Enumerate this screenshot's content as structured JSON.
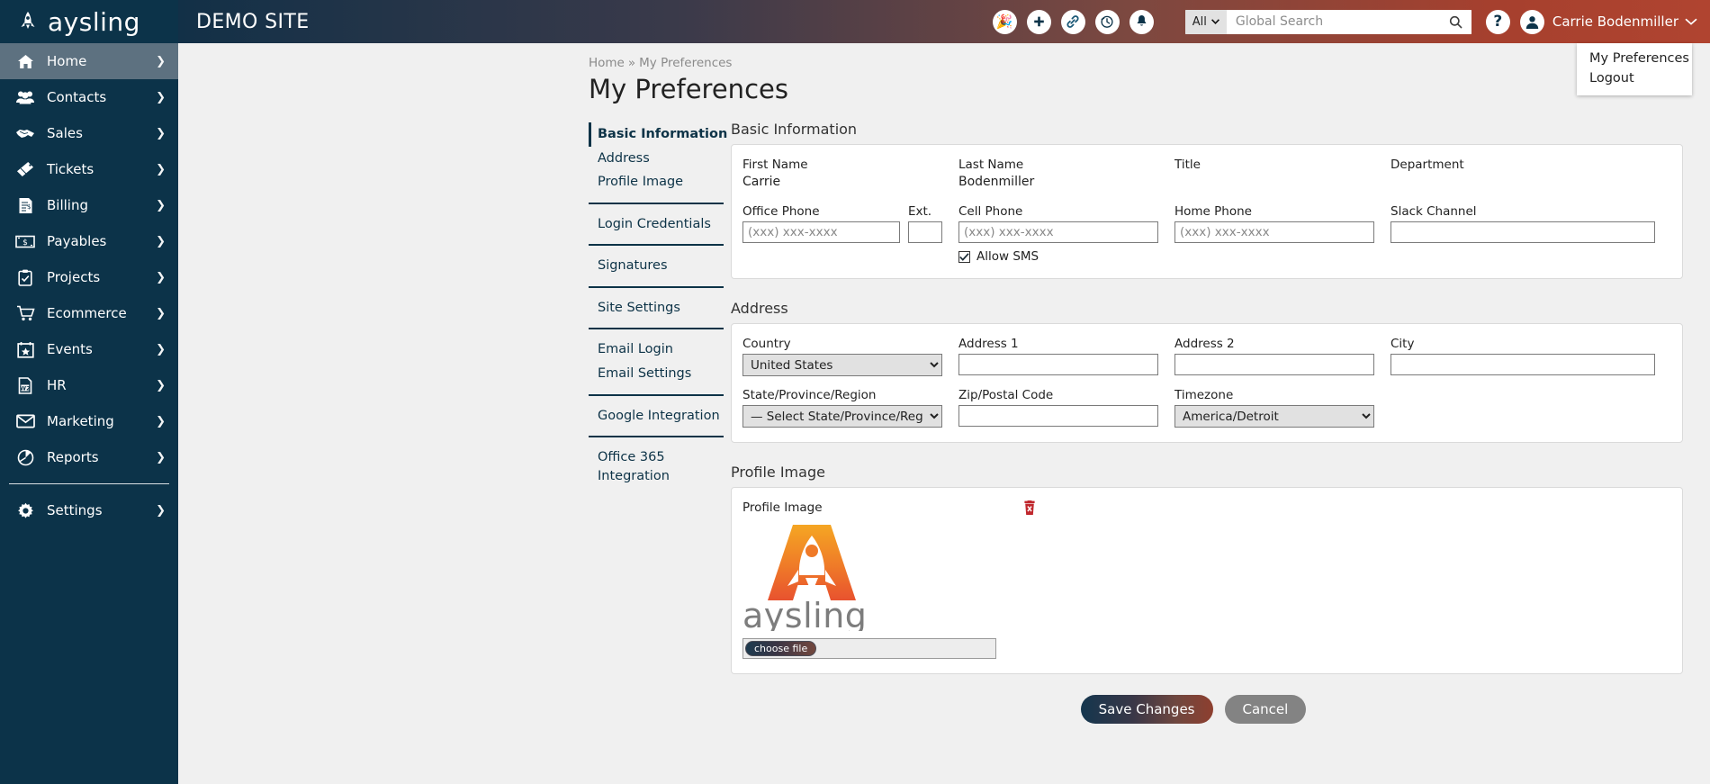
{
  "brand": {
    "word": "aysling",
    "logo_icon": "rocket-logo-icon"
  },
  "topbar": {
    "site_title": "DEMO SITE",
    "icons": [
      {
        "name": "celebrate-icon",
        "glyph": "🎉"
      },
      {
        "name": "add-icon",
        "glyph": "+"
      },
      {
        "name": "link-icon",
        "glyph": "🔗"
      },
      {
        "name": "recent-history-icon",
        "glyph": "◴"
      },
      {
        "name": "notifications-bell-icon",
        "glyph": "🔔"
      }
    ],
    "search": {
      "scope": "All",
      "placeholder": "Global Search",
      "value": ""
    },
    "help_label": "?",
    "user_name": "Carrie Bodenmiller",
    "user_menu": [
      "My Preferences",
      "Logout"
    ]
  },
  "sidebar": {
    "items": [
      {
        "label": "Home",
        "icon": "home-icon",
        "active": true
      },
      {
        "label": "Contacts",
        "icon": "contacts-icon",
        "active": false
      },
      {
        "label": "Sales",
        "icon": "handshake-icon",
        "active": false
      },
      {
        "label": "Tickets",
        "icon": "ticket-icon",
        "active": false
      },
      {
        "label": "Billing",
        "icon": "invoice-icon",
        "active": false
      },
      {
        "label": "Payables",
        "icon": "money-icon",
        "active": false
      },
      {
        "label": "Projects",
        "icon": "clipboard-check-icon",
        "active": false
      },
      {
        "label": "Ecommerce",
        "icon": "shopping-cart-icon",
        "active": false
      },
      {
        "label": "Events",
        "icon": "calendar-star-icon",
        "active": false
      },
      {
        "label": "HR",
        "icon": "w2-document-icon",
        "active": false
      },
      {
        "label": "Marketing",
        "icon": "envelope-icon",
        "active": false
      },
      {
        "label": "Reports",
        "icon": "pie-chart-icon",
        "active": false
      },
      {
        "label": "Settings",
        "icon": "gear-icon",
        "active": false
      }
    ],
    "chevron": "❯"
  },
  "page": {
    "breadcrumb": {
      "home": "Home",
      "separator": "»",
      "current": "My Preferences"
    },
    "title": "My Preferences"
  },
  "subnav": {
    "groups": [
      [
        "Basic Information",
        "Address",
        "Profile Image"
      ],
      [
        "Login Credentials"
      ],
      [
        "Signatures"
      ],
      [
        "Site Settings"
      ],
      [
        "Email Login",
        "Email Settings"
      ],
      [
        "Google Integration"
      ],
      [
        "Office 365 Integration"
      ]
    ],
    "active": "Basic Information"
  },
  "basic_information": {
    "section_title": "Basic Information",
    "first_name": {
      "label": "First Name",
      "value": "Carrie"
    },
    "last_name": {
      "label": "Last Name",
      "value": "Bodenmiller"
    },
    "title": {
      "label": "Title",
      "value": ""
    },
    "department": {
      "label": "Department",
      "value": ""
    },
    "office_phone": {
      "label": "Office Phone",
      "placeholder": "(xxx) xxx-xxxx",
      "value": ""
    },
    "ext": {
      "label": "Ext.",
      "value": ""
    },
    "cell_phone": {
      "label": "Cell Phone",
      "placeholder": "(xxx) xxx-xxxx",
      "value": ""
    },
    "home_phone": {
      "label": "Home Phone",
      "placeholder": "(xxx) xxx-xxxx",
      "value": ""
    },
    "slack_channel": {
      "label": "Slack Channel",
      "value": ""
    },
    "allow_sms": {
      "label": "Allow SMS",
      "checked": true
    }
  },
  "address": {
    "section_title": "Address",
    "country": {
      "label": "Country",
      "value": "United States"
    },
    "address1": {
      "label": "Address 1",
      "value": ""
    },
    "address2": {
      "label": "Address 2",
      "value": ""
    },
    "city": {
      "label": "City",
      "value": ""
    },
    "state": {
      "label": "State/Province/Region",
      "value": "— Select State/Province/Region —"
    },
    "zip": {
      "label": "Zip/Postal Code",
      "value": ""
    },
    "timezone": {
      "label": "Timezone",
      "value": "America/Detroit"
    }
  },
  "profile_image": {
    "section_title": "Profile Image",
    "field_label": "Profile Image",
    "delete_icon": "trash-delete-icon",
    "logo_word": "aysling",
    "choose_file_label": "choose file"
  },
  "actions": {
    "save_label": "Save Changes",
    "cancel_label": "Cancel"
  },
  "colors": {
    "sidebar": "#0c3349",
    "sidebar_active": "#5d7180",
    "header_left": "#123047",
    "header_right": "#b04430",
    "accent_orange": "#f07d22",
    "delete_red": "#c0272d",
    "page_bg": "#f0f0f0"
  }
}
